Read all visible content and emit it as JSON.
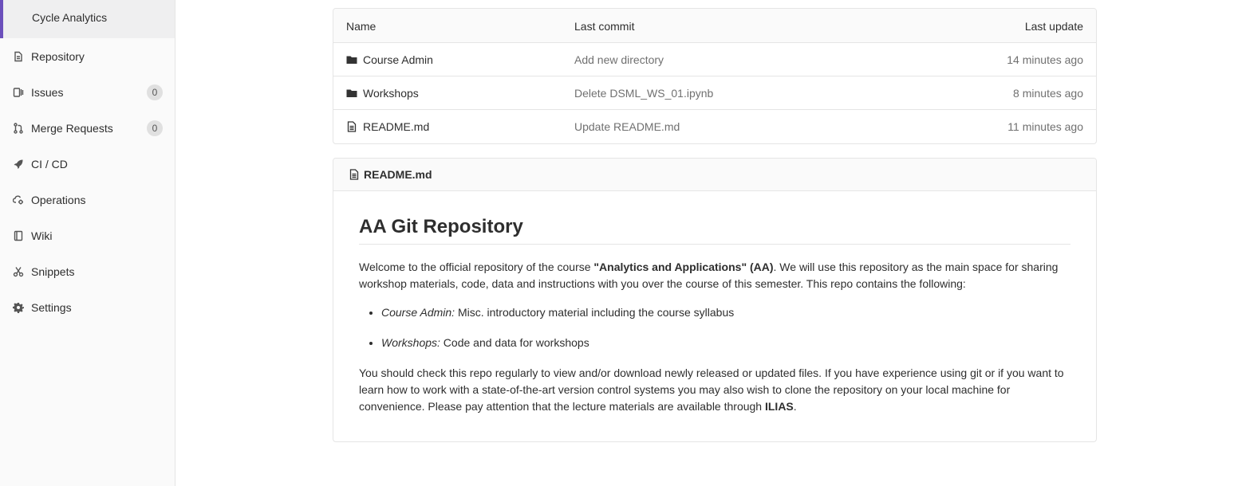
{
  "sidebar": {
    "active_sub_item": "Cycle Analytics",
    "items": [
      {
        "label": "Repository",
        "icon": "document-icon"
      },
      {
        "label": "Issues",
        "icon": "issues-icon",
        "badge": "0"
      },
      {
        "label": "Merge Requests",
        "icon": "merge-request-icon",
        "badge": "0"
      },
      {
        "label": "CI / CD",
        "icon": "rocket-icon"
      },
      {
        "label": "Operations",
        "icon": "cloud-gear-icon"
      },
      {
        "label": "Wiki",
        "icon": "book-icon"
      },
      {
        "label": "Snippets",
        "icon": "scissors-icon"
      },
      {
        "label": "Settings",
        "icon": "gear-icon"
      }
    ]
  },
  "file_table": {
    "headers": {
      "name": "Name",
      "last_commit": "Last commit",
      "last_update": "Last update"
    },
    "rows": [
      {
        "name": "Course Admin",
        "type": "folder",
        "commit": "Add new directory",
        "updated": "14 minutes ago"
      },
      {
        "name": "Workshops",
        "type": "folder",
        "commit": "Delete DSML_WS_01.ipynb",
        "updated": "8 minutes ago"
      },
      {
        "name": "README.md",
        "type": "file",
        "commit": "Update README.md",
        "updated": "11 minutes ago"
      }
    ]
  },
  "readme": {
    "filename": "README.md",
    "heading": "AA Git Repository",
    "intro_before": "Welcome to the official repository of the course ",
    "intro_bold": "\"Analytics and Applications\" (AA)",
    "intro_after": ". We will use this repository as the main space for sharing workshop materials, code, data and instructions with you over the course of this semester. This repo contains the following:",
    "list": [
      {
        "term": "Course Admin:",
        "desc": " Misc. introductory material including the course syllabus"
      },
      {
        "term": "Workshops:",
        "desc": " Code and data for workshops"
      }
    ],
    "outro_before": "You should check this repo regularly to view and/or download newly released or updated files. If you have experience using git or if you want to learn how to work with a state-of-the-art version control systems you may also wish to clone the repository on your local machine for convenience. Please pay attention that the lecture materials are available through ",
    "outro_bold": "ILIAS",
    "outro_after": "."
  },
  "colors": {
    "accent": "#6b4fbb",
    "sidebar_bg": "#fafafa",
    "border": "#e5e5e5",
    "muted_text": "#707070"
  }
}
